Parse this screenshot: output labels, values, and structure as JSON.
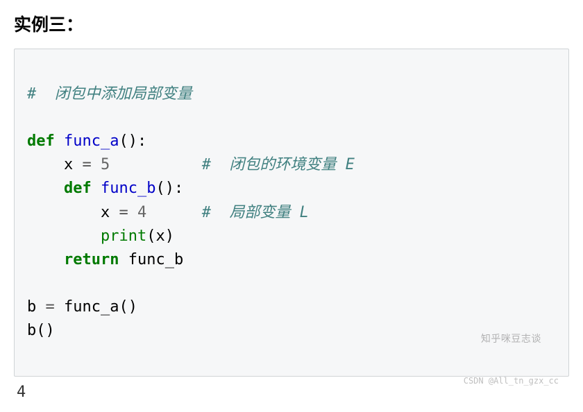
{
  "heading": "实例三：",
  "code": {
    "c_top": "#  闭包中添加局部变量",
    "kw_def1": "def",
    "fn_a": "func_a",
    "paren": "()",
    "colon": ":",
    "var_x1": "x ",
    "op_eq": "=",
    "num5": " 5",
    "c_env": "#  闭包的环境变量 E",
    "kw_def2": "def",
    "fn_b": "func_b",
    "var_x2": "x ",
    "num4": " 4",
    "c_local": "#  局部变量 L",
    "builtin_print": "print",
    "print_arg": "(x)",
    "kw_return": "return",
    "ret_val": " func_b",
    "assign_b": "b ",
    "call_a": " func_a()",
    "call_b": "b()"
  },
  "output": "4",
  "watermark_top": "知乎咪豆志谈",
  "watermark_bot": "CSDN @All_tn_gzx_cc"
}
